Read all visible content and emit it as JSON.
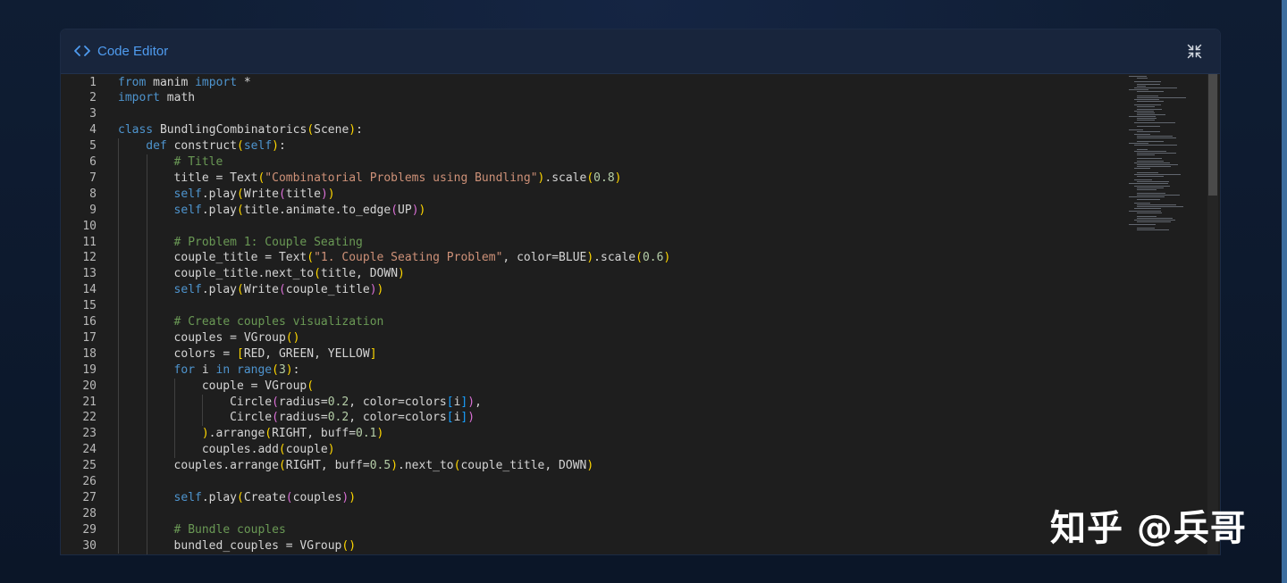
{
  "panel": {
    "title": "Code Editor",
    "header_icon": "code-brackets-icon",
    "collapse_icon": "collapse-arrows-icon"
  },
  "editor": {
    "lines": [
      {
        "n": "1",
        "indent": 0,
        "tokens": [
          [
            "kw",
            "from"
          ],
          [
            "id",
            " manim "
          ],
          [
            "kw",
            "import"
          ],
          [
            "id",
            " *"
          ]
        ]
      },
      {
        "n": "2",
        "indent": 0,
        "tokens": [
          [
            "kw",
            "import"
          ],
          [
            "id",
            " math"
          ]
        ]
      },
      {
        "n": "3",
        "indent": 0,
        "tokens": []
      },
      {
        "n": "4",
        "indent": 0,
        "tokens": [
          [
            "kw",
            "class"
          ],
          [
            "id",
            " BundlingCombinatorics"
          ],
          [
            "b1",
            "("
          ],
          [
            "id",
            "Scene"
          ],
          [
            "b1",
            ")"
          ],
          [
            "id",
            ":"
          ]
        ]
      },
      {
        "n": "5",
        "indent": 1,
        "tokens": [
          [
            "kw",
            "def"
          ],
          [
            "id",
            " construct"
          ],
          [
            "b1",
            "("
          ],
          [
            "self",
            "self"
          ],
          [
            "b1",
            ")"
          ],
          [
            "id",
            ":"
          ]
        ]
      },
      {
        "n": "6",
        "indent": 2,
        "tokens": [
          [
            "com",
            "# Title"
          ]
        ]
      },
      {
        "n": "7",
        "indent": 2,
        "tokens": [
          [
            "id",
            "title = Text"
          ],
          [
            "b1",
            "("
          ],
          [
            "str",
            "\"Combinatorial Problems using Bundling\""
          ],
          [
            "b1",
            ")"
          ],
          [
            "id",
            ".scale"
          ],
          [
            "b1",
            "("
          ],
          [
            "num",
            "0.8"
          ],
          [
            "b1",
            ")"
          ]
        ]
      },
      {
        "n": "8",
        "indent": 2,
        "tokens": [
          [
            "self",
            "self"
          ],
          [
            "id",
            ".play"
          ],
          [
            "b1",
            "("
          ],
          [
            "id",
            "Write"
          ],
          [
            "b2",
            "("
          ],
          [
            "id",
            "title"
          ],
          [
            "b2",
            ")"
          ],
          [
            "b1",
            ")"
          ]
        ]
      },
      {
        "n": "9",
        "indent": 2,
        "tokens": [
          [
            "self",
            "self"
          ],
          [
            "id",
            ".play"
          ],
          [
            "b1",
            "("
          ],
          [
            "id",
            "title.animate.to_edge"
          ],
          [
            "b2",
            "("
          ],
          [
            "id",
            "UP"
          ],
          [
            "b2",
            ")"
          ],
          [
            "b1",
            ")"
          ]
        ]
      },
      {
        "n": "10",
        "indent": 2,
        "tokens": []
      },
      {
        "n": "11",
        "indent": 2,
        "tokens": [
          [
            "com",
            "# Problem 1: Couple Seating"
          ]
        ]
      },
      {
        "n": "12",
        "indent": 2,
        "tokens": [
          [
            "id",
            "couple_title = Text"
          ],
          [
            "b1",
            "("
          ],
          [
            "str",
            "\"1. Couple Seating Problem\""
          ],
          [
            "id",
            ", color=BLUE"
          ],
          [
            "b1",
            ")"
          ],
          [
            "id",
            ".scale"
          ],
          [
            "b1",
            "("
          ],
          [
            "num",
            "0.6"
          ],
          [
            "b1",
            ")"
          ]
        ]
      },
      {
        "n": "13",
        "indent": 2,
        "tokens": [
          [
            "id",
            "couple_title.next_to"
          ],
          [
            "b1",
            "("
          ],
          [
            "id",
            "title, DOWN"
          ],
          [
            "b1",
            ")"
          ]
        ]
      },
      {
        "n": "14",
        "indent": 2,
        "tokens": [
          [
            "self",
            "self"
          ],
          [
            "id",
            ".play"
          ],
          [
            "b1",
            "("
          ],
          [
            "id",
            "Write"
          ],
          [
            "b2",
            "("
          ],
          [
            "id",
            "couple_title"
          ],
          [
            "b2",
            ")"
          ],
          [
            "b1",
            ")"
          ]
        ]
      },
      {
        "n": "15",
        "indent": 2,
        "tokens": []
      },
      {
        "n": "16",
        "indent": 2,
        "tokens": [
          [
            "com",
            "# Create couples visualization"
          ]
        ]
      },
      {
        "n": "17",
        "indent": 2,
        "tokens": [
          [
            "id",
            "couples = VGroup"
          ],
          [
            "b1",
            "()"
          ]
        ]
      },
      {
        "n": "18",
        "indent": 2,
        "tokens": [
          [
            "id",
            "colors = "
          ],
          [
            "b1",
            "["
          ],
          [
            "id",
            "RED, GREEN, YELLOW"
          ],
          [
            "b1",
            "]"
          ]
        ]
      },
      {
        "n": "19",
        "indent": 2,
        "tokens": [
          [
            "kw",
            "for"
          ],
          [
            "id",
            " i "
          ],
          [
            "kw",
            "in"
          ],
          [
            "id",
            " "
          ],
          [
            "kw",
            "range"
          ],
          [
            "b1",
            "("
          ],
          [
            "num",
            "3"
          ],
          [
            "b1",
            ")"
          ],
          [
            "id",
            ":"
          ]
        ]
      },
      {
        "n": "20",
        "indent": 3,
        "tokens": [
          [
            "id",
            "couple = VGroup"
          ],
          [
            "b1",
            "("
          ]
        ]
      },
      {
        "n": "21",
        "indent": 4,
        "tokens": [
          [
            "id",
            "Circle"
          ],
          [
            "b2",
            "("
          ],
          [
            "id",
            "radius="
          ],
          [
            "num",
            "0.2"
          ],
          [
            "id",
            ", color=colors"
          ],
          [
            "b3",
            "["
          ],
          [
            "id",
            "i"
          ],
          [
            "b3",
            "]"
          ],
          [
            "b2",
            ")"
          ],
          [
            "id",
            ","
          ]
        ]
      },
      {
        "n": "22",
        "indent": 4,
        "tokens": [
          [
            "id",
            "Circle"
          ],
          [
            "b2",
            "("
          ],
          [
            "id",
            "radius="
          ],
          [
            "num",
            "0.2"
          ],
          [
            "id",
            ", color=colors"
          ],
          [
            "b3",
            "["
          ],
          [
            "id",
            "i"
          ],
          [
            "b3",
            "]"
          ],
          [
            "b2",
            ")"
          ]
        ]
      },
      {
        "n": "23",
        "indent": 3,
        "tokens": [
          [
            "b1",
            ")"
          ],
          [
            "id",
            ".arrange"
          ],
          [
            "b1",
            "("
          ],
          [
            "id",
            "RIGHT, buff="
          ],
          [
            "num",
            "0.1"
          ],
          [
            "b1",
            ")"
          ]
        ]
      },
      {
        "n": "24",
        "indent": 3,
        "tokens": [
          [
            "id",
            "couples.add"
          ],
          [
            "b1",
            "("
          ],
          [
            "id",
            "couple"
          ],
          [
            "b1",
            ")"
          ]
        ]
      },
      {
        "n": "25",
        "indent": 2,
        "tokens": [
          [
            "id",
            "couples.arrange"
          ],
          [
            "b1",
            "("
          ],
          [
            "id",
            "RIGHT, buff="
          ],
          [
            "num",
            "0.5"
          ],
          [
            "b1",
            ")"
          ],
          [
            "id",
            ".next_to"
          ],
          [
            "b1",
            "("
          ],
          [
            "id",
            "couple_title, DOWN"
          ],
          [
            "b1",
            ")"
          ]
        ]
      },
      {
        "n": "26",
        "indent": 2,
        "tokens": []
      },
      {
        "n": "27",
        "indent": 2,
        "tokens": [
          [
            "self",
            "self"
          ],
          [
            "id",
            ".play"
          ],
          [
            "b1",
            "("
          ],
          [
            "id",
            "Create"
          ],
          [
            "b2",
            "("
          ],
          [
            "id",
            "couples"
          ],
          [
            "b2",
            ")"
          ],
          [
            "b1",
            ")"
          ]
        ]
      },
      {
        "n": "28",
        "indent": 2,
        "tokens": []
      },
      {
        "n": "29",
        "indent": 2,
        "tokens": [
          [
            "com",
            "# Bundle couples"
          ]
        ]
      },
      {
        "n": "30",
        "indent": 2,
        "tokens": [
          [
            "id",
            "bundled_couples = VGroup"
          ],
          [
            "b1",
            "()"
          ]
        ]
      }
    ]
  },
  "watermark": {
    "text": "知乎 @兵哥"
  },
  "colors": {
    "background": "#0d1a2e",
    "header": "#18253c",
    "editor_bg": "#1e1e1e",
    "accent": "#4f9cf0",
    "keyword": "#4e94ce",
    "string": "#ce9178",
    "number": "#b5cea8",
    "comment": "#6a9955",
    "bracket_1": "#ffd700",
    "bracket_2": "#da70d6",
    "bracket_3": "#179fff"
  }
}
